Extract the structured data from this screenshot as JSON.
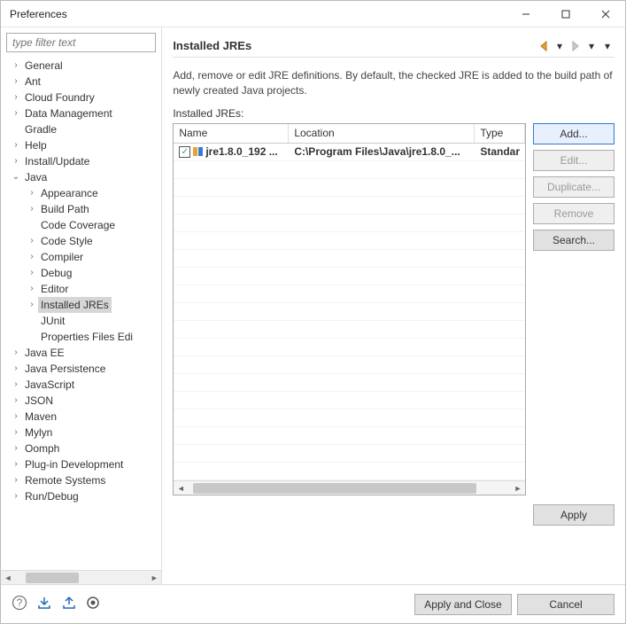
{
  "window": {
    "title": "Preferences"
  },
  "filter": {
    "placeholder": "type filter text"
  },
  "tree": [
    {
      "label": "General",
      "level": 1,
      "arrow": ">"
    },
    {
      "label": "Ant",
      "level": 1,
      "arrow": ">"
    },
    {
      "label": "Cloud Foundry",
      "level": 1,
      "arrow": ">"
    },
    {
      "label": "Data Management",
      "level": 1,
      "arrow": ">"
    },
    {
      "label": "Gradle",
      "level": 1,
      "arrow": ""
    },
    {
      "label": "Help",
      "level": 1,
      "arrow": ">"
    },
    {
      "label": "Install/Update",
      "level": 1,
      "arrow": ">"
    },
    {
      "label": "Java",
      "level": 1,
      "arrow": "v"
    },
    {
      "label": "Appearance",
      "level": 2,
      "arrow": ">"
    },
    {
      "label": "Build Path",
      "level": 2,
      "arrow": ">"
    },
    {
      "label": "Code Coverage",
      "level": 2,
      "arrow": ""
    },
    {
      "label": "Code Style",
      "level": 2,
      "arrow": ">"
    },
    {
      "label": "Compiler",
      "level": 2,
      "arrow": ">"
    },
    {
      "label": "Debug",
      "level": 2,
      "arrow": ">"
    },
    {
      "label": "Editor",
      "level": 2,
      "arrow": ">"
    },
    {
      "label": "Installed JREs",
      "level": 2,
      "arrow": ">",
      "selected": true
    },
    {
      "label": "JUnit",
      "level": 2,
      "arrow": ""
    },
    {
      "label": "Properties Files Edi",
      "level": 2,
      "arrow": ""
    },
    {
      "label": "Java EE",
      "level": 1,
      "arrow": ">"
    },
    {
      "label": "Java Persistence",
      "level": 1,
      "arrow": ">"
    },
    {
      "label": "JavaScript",
      "level": 1,
      "arrow": ">"
    },
    {
      "label": "JSON",
      "level": 1,
      "arrow": ">"
    },
    {
      "label": "Maven",
      "level": 1,
      "arrow": ">"
    },
    {
      "label": "Mylyn",
      "level": 1,
      "arrow": ">"
    },
    {
      "label": "Oomph",
      "level": 1,
      "arrow": ">"
    },
    {
      "label": "Plug-in Development",
      "level": 1,
      "arrow": ">"
    },
    {
      "label": "Remote Systems",
      "level": 1,
      "arrow": ">"
    },
    {
      "label": "Run/Debug",
      "level": 1,
      "arrow": ">"
    }
  ],
  "page": {
    "title": "Installed JREs",
    "description": "Add, remove or edit JRE definitions. By default, the checked JRE is added to the build path of newly created Java projects.",
    "list_label": "Installed JREs:"
  },
  "table": {
    "columns": {
      "name": "Name",
      "location": "Location",
      "type": "Type"
    },
    "rows": [
      {
        "checked": true,
        "name": "jre1.8.0_192 ...",
        "location": "C:\\Program Files\\Java\\jre1.8.0_...",
        "type": "Standar"
      }
    ]
  },
  "buttons": {
    "add": "Add...",
    "edit": "Edit...",
    "duplicate": "Duplicate...",
    "remove": "Remove",
    "search": "Search...",
    "apply": "Apply",
    "apply_close": "Apply and Close",
    "cancel": "Cancel"
  }
}
